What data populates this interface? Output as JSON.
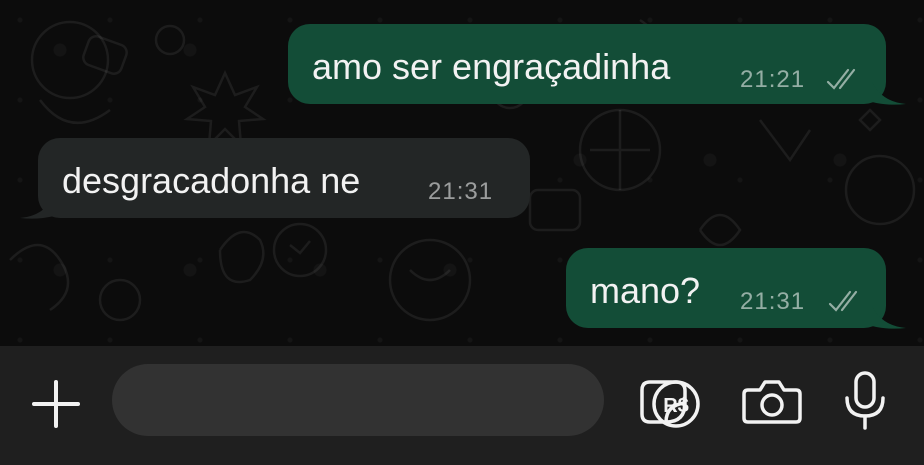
{
  "messages": [
    {
      "direction": "outgoing",
      "text": "amo ser engraçadinha",
      "time": "21:21",
      "status": "read"
    },
    {
      "direction": "incoming",
      "text": "desgracadonha ne",
      "time": "21:31"
    },
    {
      "direction": "outgoing",
      "text": "mano?",
      "time": "21:31",
      "status": "read"
    }
  ],
  "composer": {
    "message_placeholder": "",
    "plus_icon": "plus-icon",
    "sticker_icon": "sticker-icon",
    "payment_icon": "pix-real-icon",
    "payment_symbol": "R$",
    "camera_icon": "camera-icon",
    "mic_icon": "microphone-icon"
  },
  "colors": {
    "outgoing_bubble": "#134d37",
    "incoming_bubble": "#232626",
    "background": "#0c0c0c",
    "composer_bg": "#1f1f1f",
    "input_bg": "#323232"
  }
}
